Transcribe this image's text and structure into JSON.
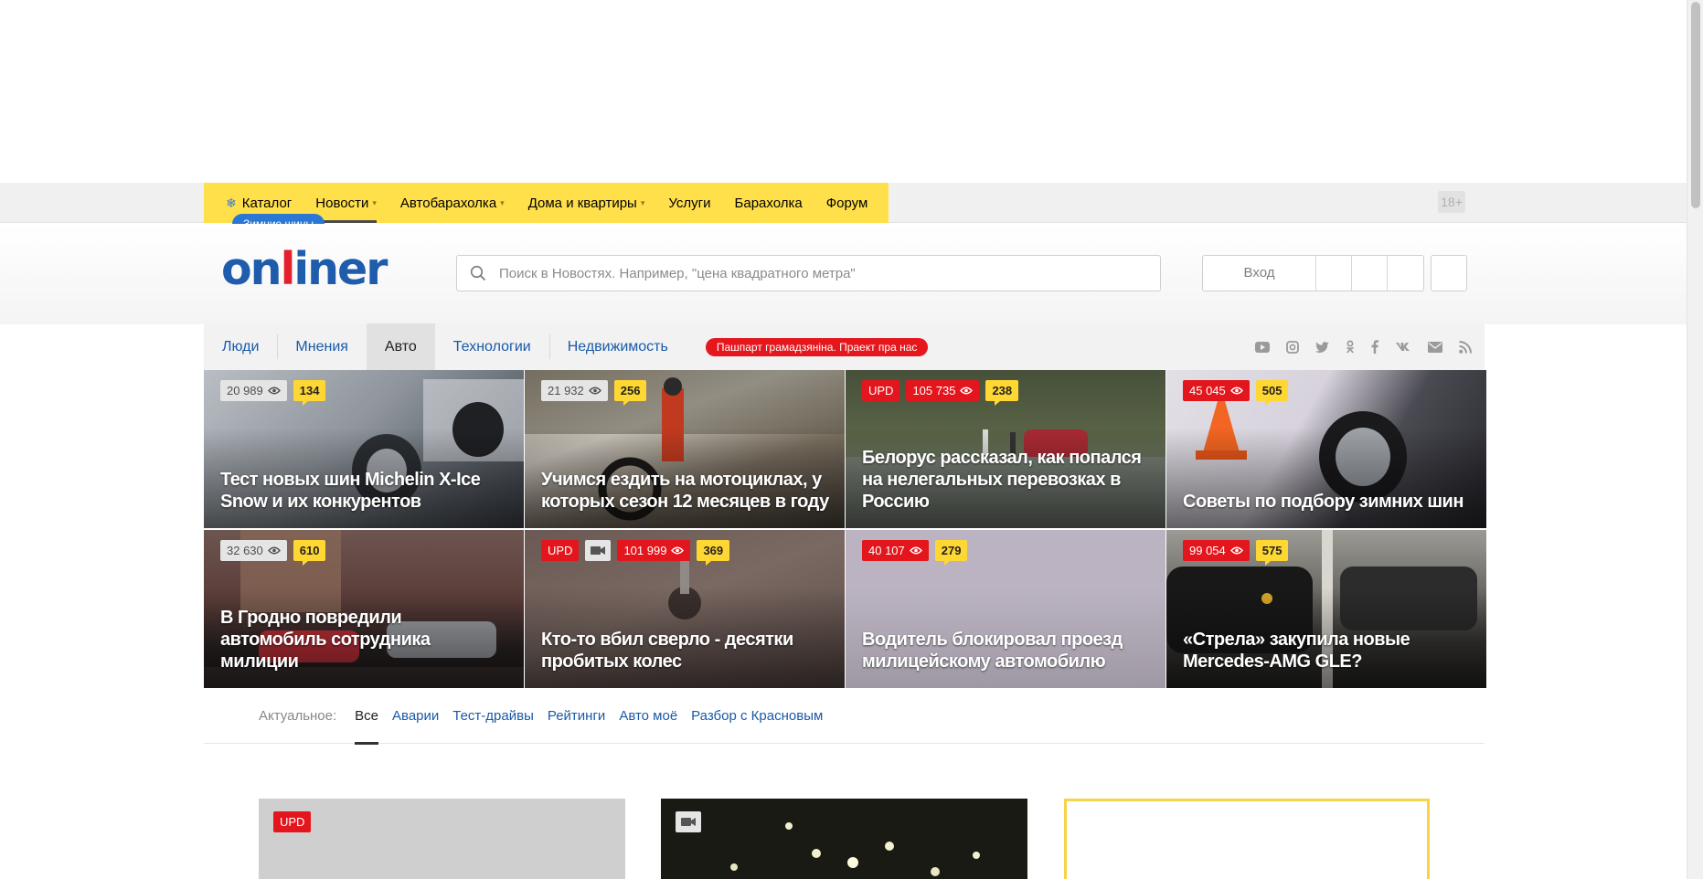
{
  "top_nav": {
    "catalog": "Каталог",
    "items": [
      {
        "label": "Новости",
        "dropdown": true
      },
      {
        "label": "Автобарахолка",
        "dropdown": true
      },
      {
        "label": "Дома и квартиры",
        "dropdown": true
      },
      {
        "label": "Услуги",
        "dropdown": false
      },
      {
        "label": "Барахолка",
        "dropdown": false
      },
      {
        "label": "Форум",
        "dropdown": false
      }
    ],
    "season_badge": "Зимние шины",
    "age_rating": "18+"
  },
  "header": {
    "logo_part1": "on",
    "logo_part2": "l",
    "logo_part3": "iner",
    "search_placeholder": "Поиск в Новостях. Например, \"цена квадратного метра\"",
    "login": "Вход"
  },
  "sections": {
    "tabs": [
      "Люди",
      "Мнения",
      "Авто",
      "Технологии",
      "Недвижимость"
    ],
    "active_tab": "Авто",
    "promo": "Пашпарт грамадзяніна. Праект пра нас",
    "socials": [
      "youtube-icon",
      "instagram-icon",
      "twitter-icon",
      "odnoklassniki-icon",
      "facebook-icon",
      "vk-icon",
      "mail-icon",
      "rss-icon"
    ]
  },
  "tiles": [
    {
      "views": "20 989",
      "comments": "134",
      "upd": false,
      "video": false,
      "hot": false,
      "title": "Тест новых шин Michelin X-Ice Snow и их конкурентов"
    },
    {
      "views": "21 932",
      "comments": "256",
      "upd": false,
      "video": false,
      "hot": false,
      "title": "Учимся ездить на мотоциклах, у которых сезон 12 месяцев в году"
    },
    {
      "views": "105 735",
      "comments": "238",
      "upd": true,
      "video": false,
      "hot": true,
      "title": "Белорус рассказал, как попался на нелегальных перевозках в Россию"
    },
    {
      "views": "45 045",
      "comments": "505",
      "upd": false,
      "video": false,
      "hot": true,
      "title": "Советы по подбору зимних шин"
    },
    {
      "views": "32 630",
      "comments": "610",
      "upd": false,
      "video": false,
      "hot": false,
      "title": "В Гродно повредили автомобиль сотрудника милиции"
    },
    {
      "views": "101 999",
      "comments": "369",
      "upd": true,
      "video": true,
      "hot": true,
      "title": "Кто-то вбил сверло - десятки пробитых колес"
    },
    {
      "views": "40 107",
      "comments": "279",
      "upd": false,
      "video": false,
      "hot": true,
      "title": "Водитель блокировал проезд милицейскому автомобилю"
    },
    {
      "views": "99 054",
      "comments": "575",
      "upd": false,
      "video": false,
      "hot": true,
      "title": "«Стрела» закупила новые Mercedes-AMG GLE?"
    }
  ],
  "actual": {
    "label": "Актуальное:",
    "links": [
      "Все",
      "Аварии",
      "Тест-драйвы",
      "Рейтинги",
      "Авто моё",
      "Разбор с Красновым"
    ],
    "active": "Все"
  },
  "cards": {
    "upd_label": "UPD"
  },
  "colors": {
    "accent_yellow": "#ffe04b",
    "brand_blue": "#1f5cac",
    "brand_red": "#e3202b",
    "link_blue": "#1a5aa8",
    "badge_red": "#e3161d"
  }
}
